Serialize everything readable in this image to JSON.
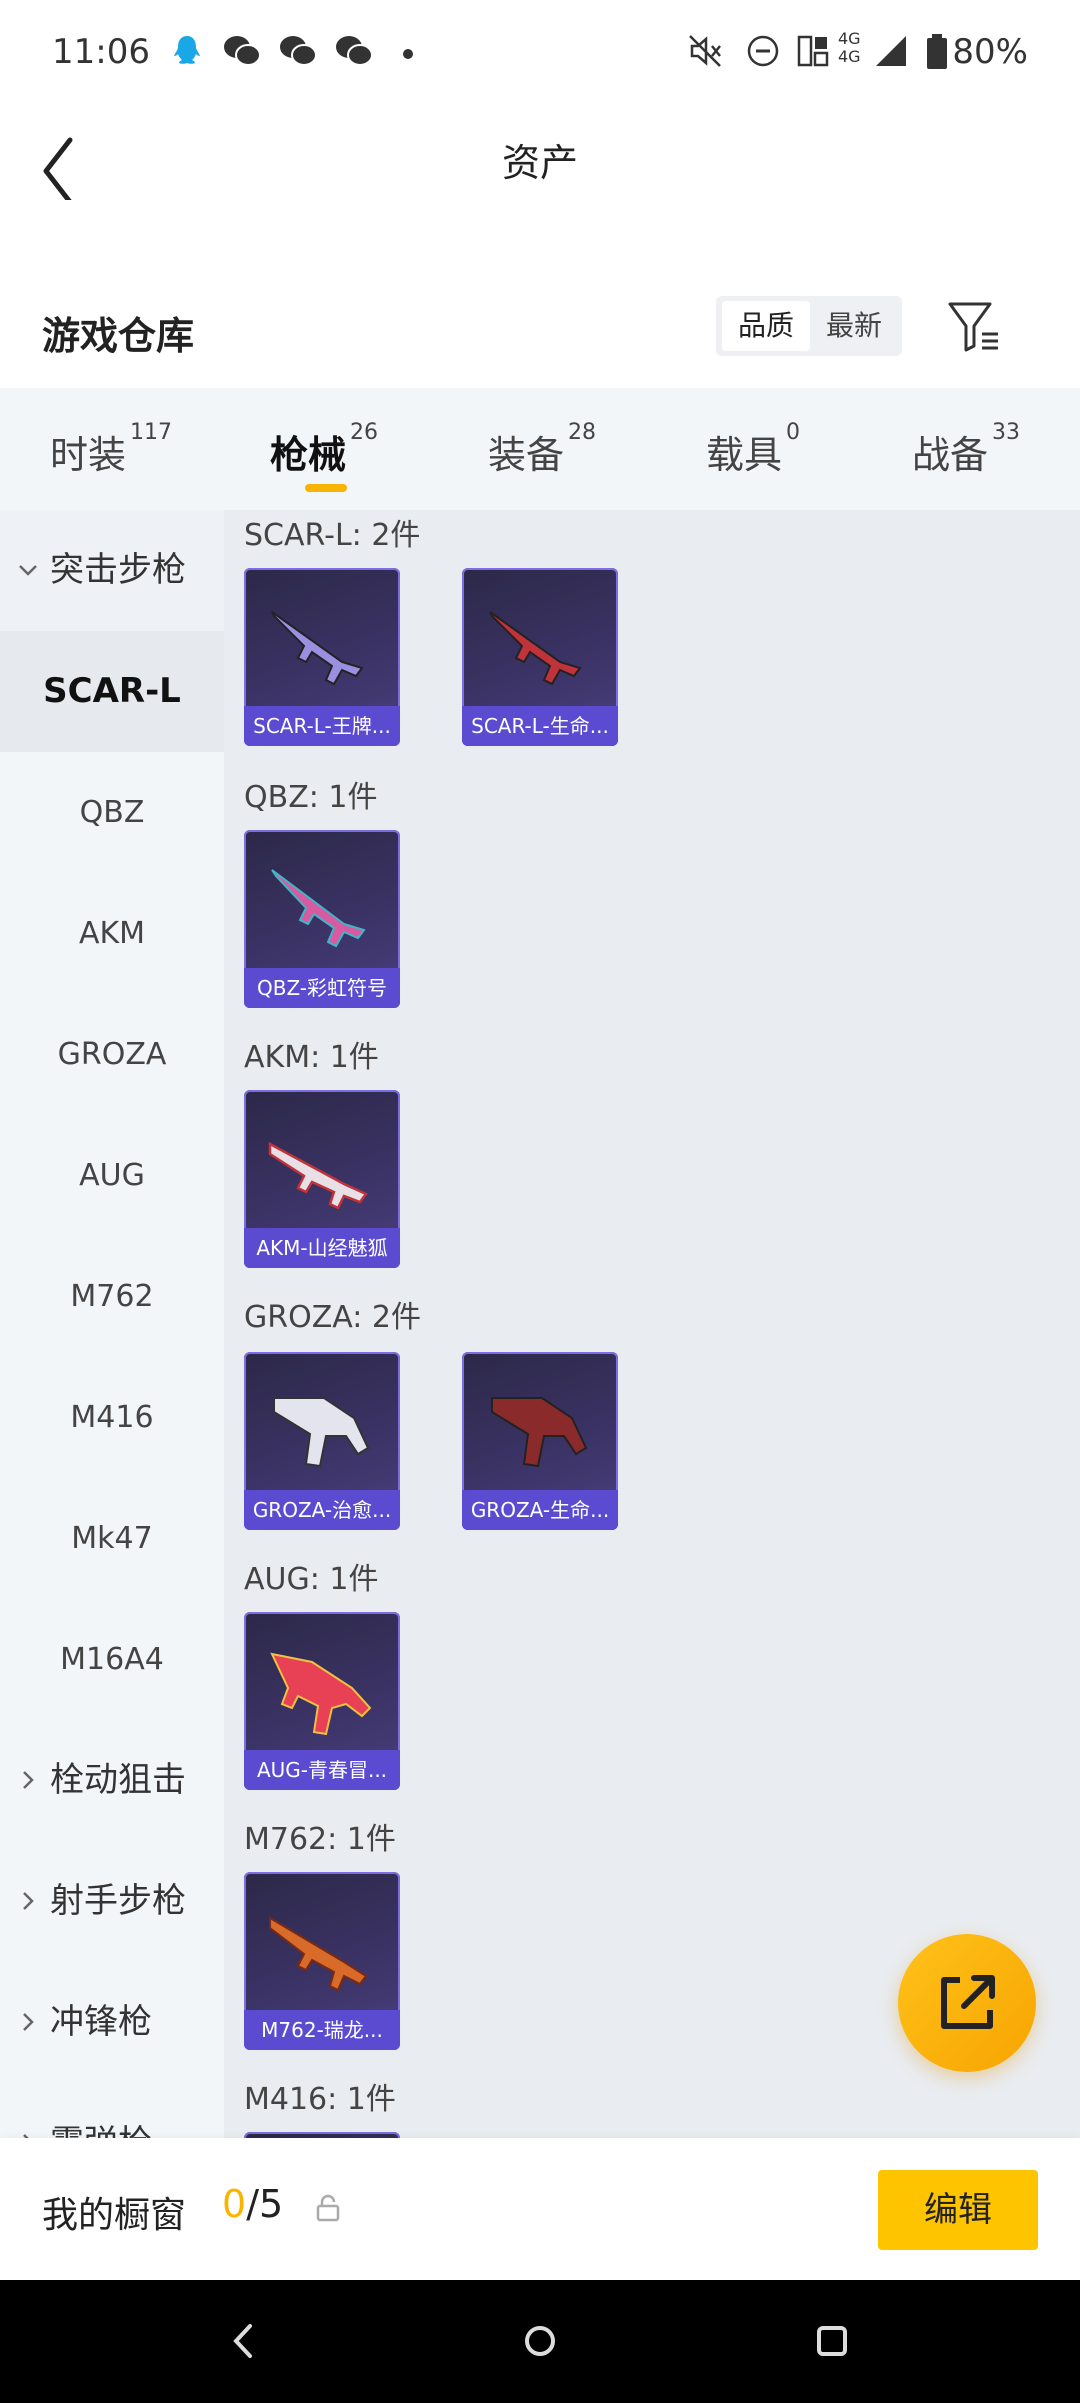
{
  "status": {
    "time": "11:06",
    "network": "4G 4G",
    "battery": "80%"
  },
  "nav": {
    "title": "资产"
  },
  "section": {
    "title": "游戏仓库",
    "sort_quality": "品质",
    "sort_newest": "最新"
  },
  "tabs": [
    {
      "label": "时装",
      "count": "117"
    },
    {
      "label": "枪械",
      "count": "26"
    },
    {
      "label": "装备",
      "count": "28"
    },
    {
      "label": "载具",
      "count": "0"
    },
    {
      "label": "战备",
      "count": "33"
    }
  ],
  "sidebar": {
    "category_open": "突击步枪",
    "items": [
      "SCAR-L",
      "QBZ",
      "AKM",
      "GROZA",
      "AUG",
      "M762",
      "M416",
      "Mk47",
      "M16A4"
    ],
    "categories": [
      "栓动狙击",
      "射手步枪",
      "冲锋枪",
      "霰弹枪"
    ]
  },
  "groups": [
    {
      "title": "SCAR-L: 2件",
      "items": [
        "SCAR-L-王牌...",
        "SCAR-L-生命..."
      ]
    },
    {
      "title": "QBZ: 1件",
      "items": [
        "QBZ-彩虹符号"
      ]
    },
    {
      "title": "AKM: 1件",
      "items": [
        "AKM-山经魅狐"
      ]
    },
    {
      "title": "GROZA: 2件",
      "items": [
        "GROZA-治愈...",
        "GROZA-生命..."
      ]
    },
    {
      "title": "AUG: 1件",
      "items": [
        "AUG-青春冒..."
      ]
    },
    {
      "title": "M762: 1件",
      "items": [
        "M762-瑞龙..."
      ]
    },
    {
      "title": "M416: 1件",
      "items": []
    }
  ],
  "bottom": {
    "label": "我的橱窗",
    "count_used": "0",
    "count_total": "/5",
    "edit": "编辑"
  },
  "colors": {
    "accent": "#f8b400",
    "card_caption": "#5a4bd1",
    "card_bg": "#3b3365"
  }
}
